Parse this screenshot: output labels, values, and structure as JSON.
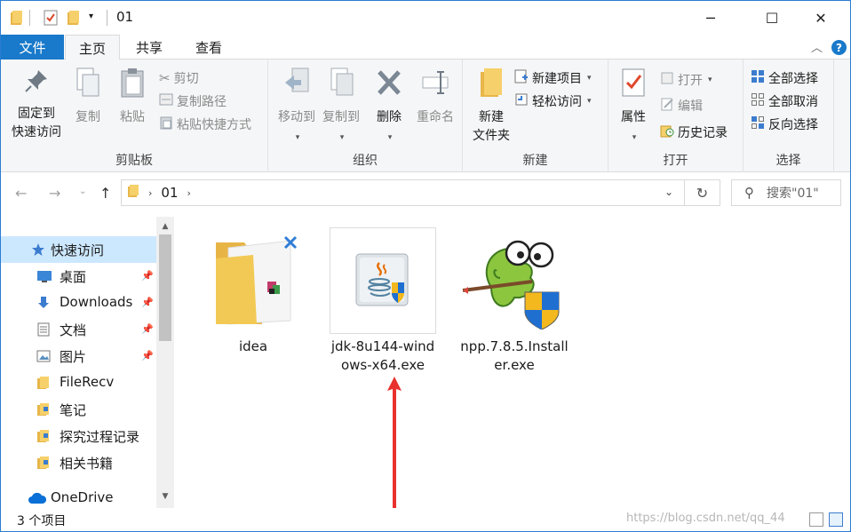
{
  "window": {
    "title": "01",
    "controls": {
      "minimize": "─",
      "maximize": "☐",
      "close": "✕"
    }
  },
  "ribbon_tabs": {
    "file": "文件",
    "items": [
      "主页",
      "共享",
      "查看"
    ],
    "active": "主页",
    "help": "?"
  },
  "ribbon": {
    "clipboard": {
      "label": "剪贴板",
      "pin": [
        "固定到",
        "快速访问"
      ],
      "copy": "复制",
      "paste": "粘贴",
      "cut": "剪切",
      "copy_path": "复制路径",
      "paste_shortcut": "粘贴快捷方式"
    },
    "organize": {
      "label": "组织",
      "move_to": "移动到",
      "copy_to": "复制到",
      "delete": "删除",
      "rename": "重命名"
    },
    "new": {
      "label": "新建",
      "new_folder": [
        "新建",
        "文件夹"
      ],
      "new_item": "新建项目",
      "easy_access": "轻松访问"
    },
    "open": {
      "label": "打开",
      "properties": "属性",
      "open": "打开",
      "edit": "编辑",
      "history": "历史记录"
    },
    "select": {
      "label": "选择",
      "select_all": "全部选择",
      "select_none": "全部取消",
      "invert": "反向选择"
    }
  },
  "address": {
    "path": [
      "01"
    ],
    "search_placeholder": "搜索\"01\""
  },
  "sidebar": {
    "items": [
      {
        "label": "快速访问",
        "icon": "star-icon",
        "selected": true,
        "pinned": false
      },
      {
        "label": "桌面",
        "icon": "desktop-icon",
        "selected": false,
        "pinned": true
      },
      {
        "label": "Downloads",
        "icon": "download-icon",
        "selected": false,
        "pinned": true
      },
      {
        "label": "文档",
        "icon": "document-icon",
        "selected": false,
        "pinned": true
      },
      {
        "label": "图片",
        "icon": "pictures-icon",
        "selected": false,
        "pinned": true
      },
      {
        "label": "FileRecv",
        "icon": "folder-icon",
        "selected": false,
        "pinned": false
      },
      {
        "label": "笔记",
        "icon": "folder-icon",
        "selected": false,
        "pinned": false
      },
      {
        "label": "探究过程记录",
        "icon": "folder-icon",
        "selected": false,
        "pinned": false
      },
      {
        "label": "相关书籍",
        "icon": "folder-icon",
        "selected": false,
        "pinned": false
      },
      {
        "label": "OneDrive",
        "icon": "cloud-icon",
        "selected": false,
        "pinned": false
      }
    ]
  },
  "files": [
    {
      "name": "idea",
      "icon": "folder-icon"
    },
    {
      "name": "jdk-8u144-windows-x64.exe",
      "line1": "jdk-8u144-wind",
      "line2": "ows-x64.exe",
      "icon": "java-installer-icon"
    },
    {
      "name": "npp.7.8.5.Installer.exe",
      "line1": "npp.7.8.5.Install",
      "line2": "er.exe",
      "icon": "notepadpp-installer-icon"
    }
  ],
  "status": {
    "count": "3 个项目",
    "watermark": "https://blog.csdn.net/qq_44"
  },
  "colors": {
    "accent": "#1979ca",
    "selected": "#cce8ff",
    "arrow": "#e8312e"
  }
}
